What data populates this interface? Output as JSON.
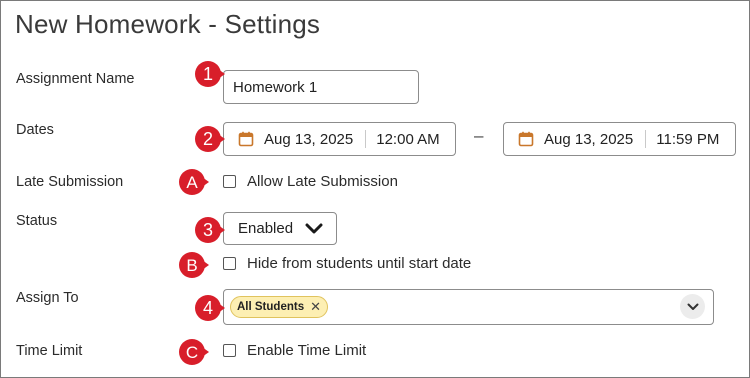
{
  "page": {
    "title": "New Homework - Settings"
  },
  "labels": {
    "assignment_name": "Assignment Name",
    "dates": "Dates",
    "late_submission": "Late Submission",
    "status": "Status",
    "assign_to": "Assign To",
    "time_limit": "Time Limit"
  },
  "assignment_name": {
    "value": "Homework 1"
  },
  "dates": {
    "start_date": "Aug 13, 2025",
    "start_time": "12:00 AM",
    "separator": "–",
    "end_date": "Aug 13, 2025",
    "end_time": "11:59 PM"
  },
  "late_submission": {
    "checkbox_label": "Allow Late Submission",
    "checked": false
  },
  "status": {
    "selected": "Enabled"
  },
  "hide_students": {
    "checkbox_label": "Hide from students until start date",
    "checked": false
  },
  "assign_to": {
    "chips": [
      "All Students"
    ]
  },
  "time_limit": {
    "checkbox_label": "Enable Time Limit",
    "checked": false
  },
  "callouts": {
    "assignment_name": "1",
    "dates": "2",
    "late_submission": "A",
    "status": "3",
    "hide_students": "B",
    "assign_to": "4",
    "time_limit": "C"
  },
  "colors": {
    "callout": "#d81e2a",
    "calendar_icon": "#c9772b",
    "chip_bg": "#fdefb3"
  },
  "icons": {
    "calendar": "calendar-icon",
    "dropdown": "chevron-down-icon",
    "remove": "close-icon"
  }
}
